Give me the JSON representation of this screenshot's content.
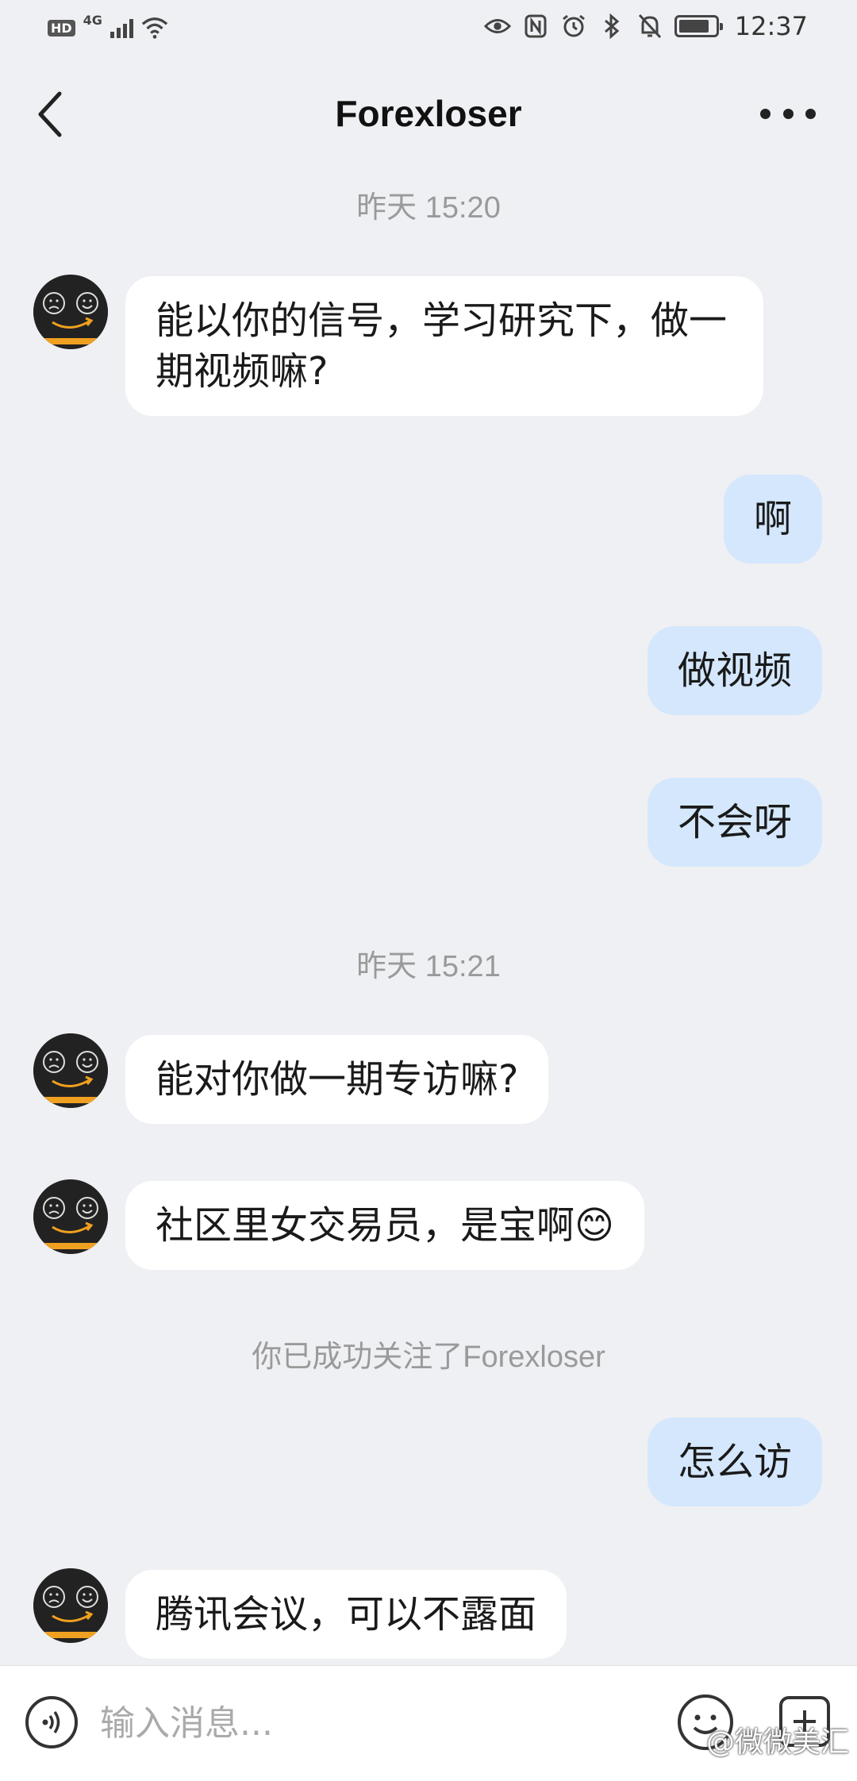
{
  "status_bar": {
    "hd": "HD",
    "network": "4G",
    "time": "12:37",
    "battery_level": 0.85,
    "icons": [
      "eye-icon",
      "nfc-icon",
      "alarm-icon",
      "bluetooth-icon",
      "mute-icon",
      "battery-icon"
    ]
  },
  "header": {
    "title": "Forexloser",
    "back_icon": "chevron-left-icon",
    "more_icon": "more-dots-icon"
  },
  "messages": [
    {
      "type": "timestamp",
      "text": "昨天 15:20"
    },
    {
      "type": "in",
      "text": "能以你的信号，学习研究下，做一期视频嘛?"
    },
    {
      "type": "out",
      "text": "啊"
    },
    {
      "type": "out",
      "text": "做视频"
    },
    {
      "type": "out",
      "text": "不会呀"
    },
    {
      "type": "timestamp",
      "text": "昨天 15:21"
    },
    {
      "type": "in",
      "text": "能对你做一期专访嘛?"
    },
    {
      "type": "in",
      "text": "社区里女交易员，是宝啊😊"
    },
    {
      "type": "system",
      "text": "你已成功关注了Forexloser"
    },
    {
      "type": "out",
      "text": "怎么访"
    },
    {
      "type": "in",
      "text": "腾讯会议，可以不露面"
    }
  ],
  "input_bar": {
    "placeholder": "输入消息...",
    "voice_icon": "voice-icon",
    "emoji_icon": "emoji-icon",
    "plus_icon": "plus-icon"
  },
  "watermark": "@微微美汇",
  "colors": {
    "background": "#eff0f3",
    "incoming_bubble": "#ffffff",
    "outgoing_bubble": "#d4e7fd",
    "timestamp_text": "#9a9a9a"
  }
}
